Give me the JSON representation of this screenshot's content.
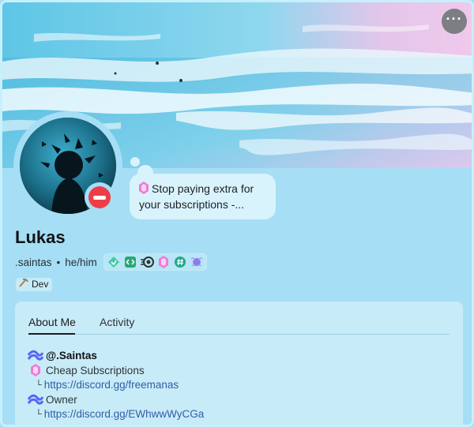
{
  "header": {
    "more_icon": "more-horizontal-icon",
    "more_label": "···"
  },
  "status": {
    "type": "do-not-disturb",
    "color": "#ef3d48"
  },
  "custom_status": {
    "icon": "pink-gem-icon",
    "text_line1": "Stop paying extra for",
    "text_line2": "your subscriptions -..."
  },
  "profile": {
    "display_name": "Lukas",
    "username": ".saintas",
    "separator": "•",
    "pronouns": "he/him",
    "badges": [
      "hypesquad-balance-badge",
      "active-developer-badge",
      "nitro-badge",
      "server-boost-badge",
      "hashtag-badge",
      "quest-badge"
    ]
  },
  "role": {
    "icon": "pickaxe-icon",
    "label": "Dev"
  },
  "tabs": [
    {
      "label": "About Me",
      "active": true
    },
    {
      "label": "Activity",
      "active": false
    }
  ],
  "about": {
    "lines": [
      {
        "icon": "wave-icon",
        "text": "@.Saintas"
      },
      {
        "icon": "pink-gem-icon",
        "text": "Cheap Subscriptions"
      },
      {
        "prefix": "└",
        "link": "https://discord.gg/freemanas"
      },
      {
        "icon": "wave-icon",
        "text": "Owner"
      },
      {
        "prefix": "└",
        "link": "https://discord.gg/EWhwwWyCGa"
      }
    ]
  },
  "colors": {
    "background": "#a6def5",
    "link": "#2f5fa8",
    "dnd": "#ef3d48"
  }
}
